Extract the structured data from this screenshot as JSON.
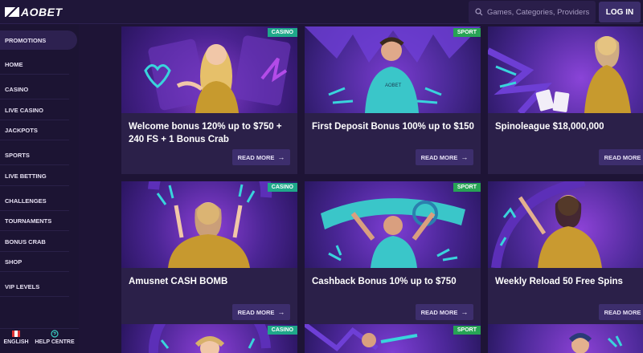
{
  "header": {
    "logo": "AOBET",
    "search_placeholder": "Games, Categories, Providers",
    "login_label": "LOG IN"
  },
  "sidebar": {
    "items": [
      {
        "label": "PROMOTIONS"
      },
      {
        "label": "HOME"
      },
      {
        "label": "CASINO"
      },
      {
        "label": "LIVE CASINO"
      },
      {
        "label": "JACKPOTS"
      },
      {
        "label": "SPORTS"
      },
      {
        "label": "LIVE BETTING"
      },
      {
        "label": "CHALLENGES"
      },
      {
        "label": "TOURNAMENTS"
      },
      {
        "label": "BONUS CRAB"
      },
      {
        "label": "SHOP"
      },
      {
        "label": "VIP LEVELS"
      }
    ],
    "language_label": "ENGLISH",
    "help_label": "HELP CENTRE"
  },
  "promotions": [
    {
      "tag": "CASINO",
      "title": "Welcome bonus 120% up to $750 + 240 FS + 1 Bonus Crab",
      "cta": "READ MORE"
    },
    {
      "tag": "SPORT",
      "title": "First Deposit Bonus 100% up to $150",
      "cta": "READ MORE"
    },
    {
      "tag": "",
      "title": "Spinoleague $18,000,000",
      "cta": "READ MORE"
    },
    {
      "tag": "CASINO",
      "title": "Amusnet CASH BOMB",
      "cta": "READ MORE"
    },
    {
      "tag": "SPORT",
      "title": "Cashback Bonus 10% up to $750",
      "cta": "READ MORE"
    },
    {
      "tag": "",
      "title": "Weekly Reload 50 Free Spins",
      "cta": "READ MORE"
    },
    {
      "tag": "CASINO",
      "title": "",
      "cta": ""
    },
    {
      "tag": "SPORT",
      "title": "",
      "cta": ""
    },
    {
      "tag": "",
      "title": "",
      "cta": ""
    }
  ],
  "icons": {
    "search": "search-icon",
    "arrow": "arrow-right-icon",
    "help": "help-icon",
    "flag": "canada-flag-icon"
  },
  "colors": {
    "background": "#1e1436",
    "card": "#2b2049",
    "casino_badge": "#1fa88a",
    "sport_badge": "#27a355",
    "button": "#3d2e6d"
  }
}
